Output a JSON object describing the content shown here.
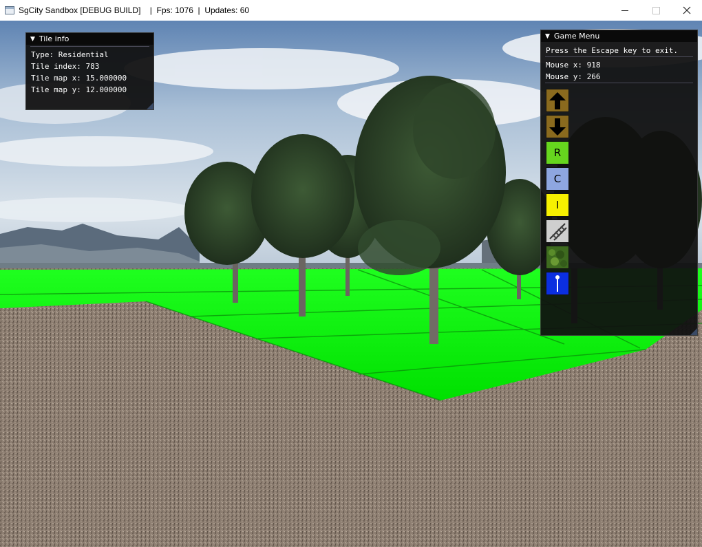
{
  "window": {
    "title": "SgCity Sandbox [DEBUG BUILD]    |  Fps: 1076  |  Updates: 60"
  },
  "tile_info": {
    "title": "Tile info",
    "type_line": "Type: Residential",
    "index_line": "Tile index: 783",
    "map_x_line": "Tile map x: 15.000000",
    "map_y_line": "Tile map y: 12.000000"
  },
  "game_menu": {
    "title": "Game Menu",
    "exit_hint": "Press the Escape key to exit.",
    "mouse_x_line": "Mouse x: 918",
    "mouse_y_line": "Mouse y: 266",
    "tools": [
      {
        "name": "raise-terrain",
        "icon": "arrow-up-icon",
        "color": "#8a6a1e"
      },
      {
        "name": "lower-terrain",
        "icon": "arrow-down-icon",
        "color": "#8a6a1e"
      },
      {
        "name": "residential",
        "label": "R",
        "color": "#66d61e"
      },
      {
        "name": "commercial",
        "label": "C",
        "color": "#8ea6e0"
      },
      {
        "name": "industrial",
        "label": "I",
        "color": "#f7f000"
      },
      {
        "name": "road",
        "icon": "road-icon",
        "color": "#cfcfcf"
      },
      {
        "name": "trees",
        "icon": "trees-icon",
        "color": "#3e6b1f"
      },
      {
        "name": "info",
        "icon": "info-pin-icon",
        "color": "#0b2fe0"
      }
    ]
  },
  "colors": {
    "zone_green": "#00f000",
    "ground": "#8e7f72",
    "sky_top": "#6c8fba",
    "panel_bg": "#101010"
  }
}
